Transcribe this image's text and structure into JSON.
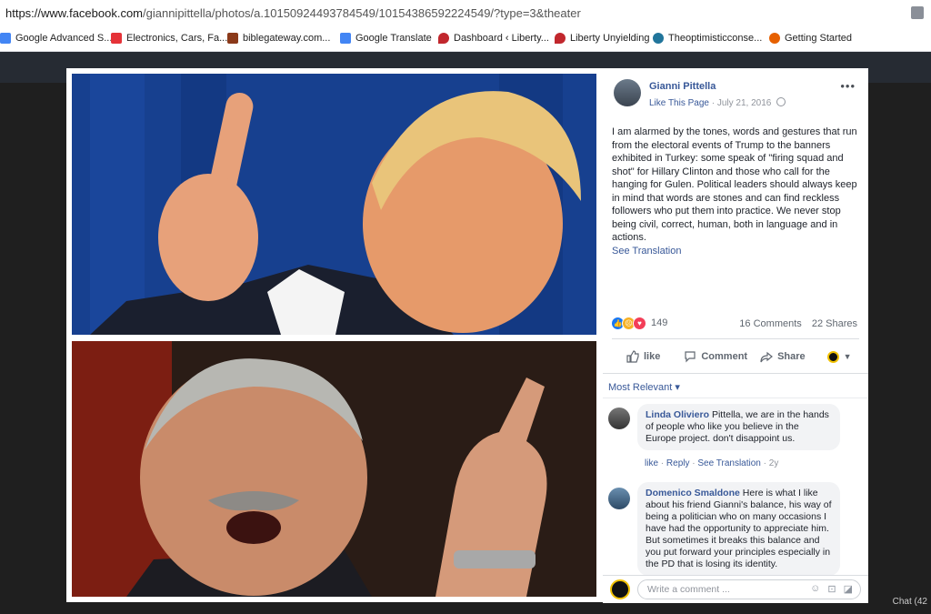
{
  "browser": {
    "url_prefix": "https://www.facebook.com",
    "url_path": "/giannipittella/photos/a.10150924493784549/10154386592224549/?type=3&theater",
    "bookmarks": [
      {
        "label": "Google Advanced S...",
        "color": "#4285f4"
      },
      {
        "label": "Electronics, Cars, Fa...",
        "color": "#e53238"
      },
      {
        "label": "biblegateway.com...",
        "color": "#8b3a1a"
      },
      {
        "label": "Google Translate",
        "color": "#4285f4"
      },
      {
        "label": "Dashboard ‹ Liberty...",
        "color": "#c1272d"
      },
      {
        "label": "Liberty Unyielding",
        "color": "#c1272d"
      },
      {
        "label": "Theoptimisticconse...",
        "color": "#21759b"
      },
      {
        "label": "Getting Started",
        "color": "#e66000"
      }
    ]
  },
  "post": {
    "author": "Gianni Pittella",
    "like_page": "Like This Page",
    "date": "July 21, 2016",
    "more": "•••",
    "text": "I am alarmed by the tones, words and gestures that run from the electoral events of Trump to the banners exhibited in Turkey: some speak of \"firing squad and shot\" for Hillary Clinton and those who call for the hanging for Gulen. Political leaders should always keep in mind that words are stones and can find reckless followers who put them into practice. We never stop being civil, correct, human, both in language and in actions.",
    "see_translation": "See Translation",
    "reaction_count": "149",
    "comments_count": "16 Comments",
    "shares_count": "22 Shares",
    "actions": {
      "like": "like",
      "comment": "Comment",
      "share": "Share"
    },
    "sort_label": "Most Relevant",
    "sort_arrow": "▾"
  },
  "comments": [
    {
      "name": "Linda Oliviero",
      "text": "Pittella, we are in the hands of people who like you believe in the Europe project. don't disappoint us.",
      "like": "like",
      "reply": "Reply",
      "translate": "See Translation",
      "age": "2y"
    },
    {
      "name": "Domenico Smaldone",
      "text": "Here is what I like about his friend Gianni's balance, his way of being a politician who on many occasions I have had the opportunity to appreciate him. But sometimes it breaks this balance and you put forward your principles especially in the PD that is losing its identity."
    }
  ],
  "composer": {
    "placeholder": "Write a comment ..."
  },
  "chat": {
    "label": "Chat (42"
  },
  "colors": {
    "link": "#385898",
    "page_bg": "#1c1c1c"
  }
}
